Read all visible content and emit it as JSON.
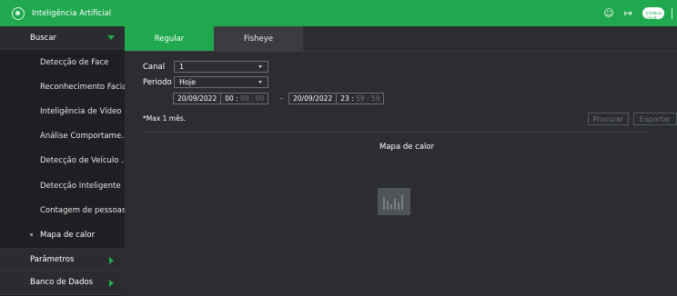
{
  "header": {
    "title": "Inteligência Artificial",
    "cloud_label": "Intelbras Cloud",
    "accent": "#20a84f"
  },
  "sidebar": {
    "group_search": "Buscar",
    "items": [
      "Detecção de Face",
      "Reconhecimento Facial",
      "Inteligência de Vídeo",
      "Análise Comportame...",
      "Detecção de Veículo ...",
      "Detecção Inteligente",
      "Contagem de pessoas",
      "Mapa de calor"
    ],
    "active_item": "Mapa de calor",
    "group_params": "Parâmetros",
    "group_db": "Banco de Dados"
  },
  "tabs": [
    "Regular",
    "Fisheye"
  ],
  "form": {
    "canal_label": "Canal",
    "canal_value": "1",
    "periodo_label": "Periodo",
    "periodo_value": "Hoje",
    "start_date": "20/09/2022",
    "start_time_h": "00 :",
    "start_time_rest": "00 : 00",
    "dash": "-",
    "end_date": "20/09/2022",
    "end_time_h": "23 :",
    "end_time_rest": "59 : 59",
    "max_note": "*Max 1 mês."
  },
  "buttons": {
    "search": "Procurar",
    "export": "Exportar"
  },
  "heatmap": {
    "title": "Mapa de calor",
    "icon": "bar-chart-icon"
  }
}
